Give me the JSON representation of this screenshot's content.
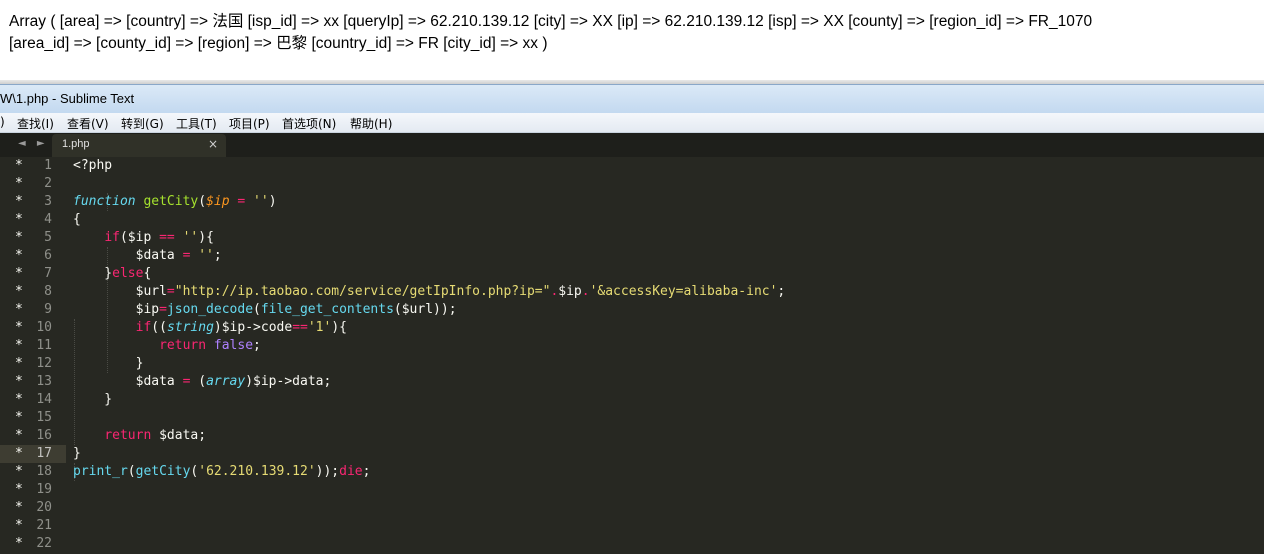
{
  "output": {
    "line1": "Array ( [area] => [country] => 法国 [isp_id] => xx [queryIp] => 62.210.139.12 [city] => XX [ip] => 62.210.139.12 [isp] => XX [county] => [region_id] => FR_1070",
    "line2": "[area_id] => [county_id] => [region] => 巴黎 [country_id] => FR [city_id] => xx )"
  },
  "window": {
    "title": "W\\1.php - Sublime Text"
  },
  "menu": {
    "items": [
      ")",
      "查找(I)",
      "查看(V)",
      "转到(G)",
      "工具(T)",
      "项目(P)",
      "首选项(N)",
      "帮助(H)"
    ]
  },
  "tabs": {
    "nav": "◄ ►",
    "active": {
      "label": "1.php",
      "close": "×"
    }
  },
  "editor": {
    "current_line": 17,
    "colors": {
      "background": "#272822",
      "foreground": "#F8F8F2",
      "keyword": "#F92672",
      "storage": "#66D9EF",
      "function": "#A6E22E",
      "parameter": "#FD971F",
      "string": "#E6DB74",
      "constant": "#AE81FF"
    },
    "lines": [
      {
        "n": "1",
        "mark": "*",
        "tokens": [
          [
            "<?php",
            "t"
          ]
        ]
      },
      {
        "n": "2",
        "mark": "*",
        "tokens": []
      },
      {
        "n": "3",
        "mark": "*",
        "tokens": [
          [
            "function",
            "s"
          ],
          [
            " ",
            "t"
          ],
          [
            "getCity",
            "f"
          ],
          [
            "(",
            "t"
          ],
          [
            "$ip",
            "p"
          ],
          [
            " = ",
            "k"
          ],
          [
            "''",
            "q"
          ],
          [
            ")",
            "t"
          ]
        ]
      },
      {
        "n": "4",
        "mark": "*",
        "tokens": [
          [
            "{",
            "t"
          ]
        ]
      },
      {
        "n": "5",
        "mark": "*",
        "tokens": [
          [
            "    ",
            "t"
          ],
          [
            "if",
            "k"
          ],
          [
            "($ip ",
            "t"
          ],
          [
            "==",
            "k"
          ],
          [
            " ",
            "t"
          ],
          [
            "''",
            "q"
          ],
          [
            "){",
            "t"
          ]
        ]
      },
      {
        "n": "6",
        "mark": "*",
        "tokens": [
          [
            "        $data ",
            "t"
          ],
          [
            "=",
            "k"
          ],
          [
            " ",
            "t"
          ],
          [
            "''",
            "q"
          ],
          [
            ";",
            "t"
          ]
        ]
      },
      {
        "n": "7",
        "mark": "*",
        "tokens": [
          [
            "    }",
            "t"
          ],
          [
            "else",
            "k"
          ],
          [
            "{",
            "t"
          ]
        ]
      },
      {
        "n": "8",
        "mark": "*",
        "tokens": [
          [
            "        $url",
            "t"
          ],
          [
            "=",
            "k"
          ],
          [
            "\"http://ip.taobao.com/service/getIpInfo.php?ip=\"",
            "q"
          ],
          [
            ".",
            "k"
          ],
          [
            "$ip",
            "t"
          ],
          [
            ".",
            "k"
          ],
          [
            "'&accessKey=alibaba-inc'",
            "q"
          ],
          [
            ";",
            "t"
          ]
        ]
      },
      {
        "n": "9",
        "mark": "*",
        "tokens": [
          [
            "        $ip",
            "t"
          ],
          [
            "=",
            "k"
          ],
          [
            "json_decode",
            "c"
          ],
          [
            "(",
            "t"
          ],
          [
            "file_get_contents",
            "c"
          ],
          [
            "($url));",
            "t"
          ]
        ]
      },
      {
        "n": "10",
        "mark": "*",
        "tokens": [
          [
            "        ",
            "t"
          ],
          [
            "if",
            "k"
          ],
          [
            "((",
            "t"
          ],
          [
            "string",
            "sp"
          ],
          [
            ")$ip->code",
            "t"
          ],
          [
            "==",
            "k"
          ],
          [
            "'1'",
            "q"
          ],
          [
            "){",
            "t"
          ]
        ]
      },
      {
        "n": "11",
        "mark": "*",
        "tokens": [
          [
            "           ",
            "t"
          ],
          [
            "return",
            "k"
          ],
          [
            " ",
            "t"
          ],
          [
            "false",
            "v"
          ],
          [
            ";",
            "t"
          ]
        ]
      },
      {
        "n": "12",
        "mark": "*",
        "tokens": [
          [
            "        }",
            "t"
          ]
        ]
      },
      {
        "n": "13",
        "mark": "*",
        "tokens": [
          [
            "        $data ",
            "t"
          ],
          [
            "=",
            "k"
          ],
          [
            " (",
            "t"
          ],
          [
            "array",
            "sp"
          ],
          [
            ")$ip->data;",
            "t"
          ]
        ]
      },
      {
        "n": "14",
        "mark": "*",
        "tokens": [
          [
            "    }",
            "t"
          ]
        ]
      },
      {
        "n": "15",
        "mark": "*",
        "tokens": []
      },
      {
        "n": "16",
        "mark": "*",
        "tokens": [
          [
            "    ",
            "t"
          ],
          [
            "return",
            "k"
          ],
          [
            " $data;",
            "t"
          ]
        ]
      },
      {
        "n": "17",
        "mark": "*",
        "tokens": [
          [
            "}",
            "t"
          ]
        ]
      },
      {
        "n": "18",
        "mark": "*",
        "tokens": [
          [
            "print_r",
            "c"
          ],
          [
            "(",
            "t"
          ],
          [
            "getCity",
            "c"
          ],
          [
            "(",
            "t"
          ],
          [
            "'62.210.139.12'",
            "q"
          ],
          [
            "));",
            "t"
          ],
          [
            "die",
            "k"
          ],
          [
            ";",
            "t"
          ]
        ]
      },
      {
        "n": "19",
        "mark": "*",
        "tokens": []
      },
      {
        "n": "20",
        "mark": "*",
        "tokens": []
      },
      {
        "n": "21",
        "mark": "*",
        "tokens": []
      },
      {
        "n": "22",
        "mark": "*",
        "tokens": []
      }
    ]
  }
}
